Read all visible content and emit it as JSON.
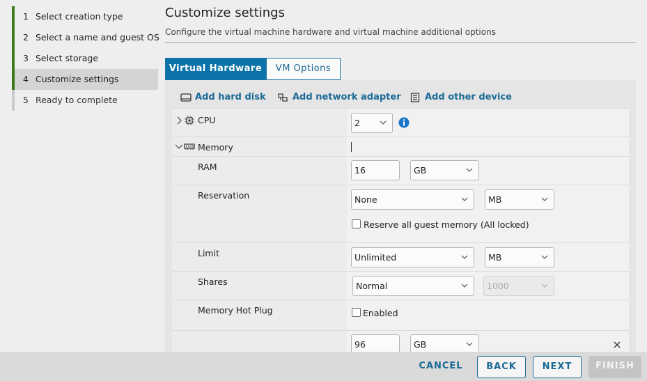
{
  "steps": [
    {
      "num": "1",
      "label": "Select creation type"
    },
    {
      "num": "2",
      "label": "Select a name and guest OS"
    },
    {
      "num": "3",
      "label": "Select storage"
    },
    {
      "num": "4",
      "label": "Customize settings"
    },
    {
      "num": "5",
      "label": "Ready to complete"
    }
  ],
  "page": {
    "title": "Customize settings",
    "subtitle": "Configure the virtual machine hardware and virtual machine additional options"
  },
  "tabs": {
    "virtual_hardware": "Virtual Hardware",
    "vm_options": "VM Options"
  },
  "actions": {
    "add_hard_disk": "Add hard disk",
    "add_network_adapter": "Add network adapter",
    "add_other_device": "Add other device"
  },
  "hardware": {
    "cpu": {
      "label": "CPU",
      "value": "2"
    },
    "memory": {
      "label": "Memory",
      "ram": {
        "label": "RAM",
        "value": "16",
        "unit": "GB"
      },
      "reservation": {
        "label": "Reservation",
        "value": "None",
        "unit": "MB",
        "checkbox_label": "Reserve all guest memory (All locked)",
        "checked": false
      },
      "limit": {
        "label": "Limit",
        "value": "Unlimited",
        "unit": "MB"
      },
      "shares": {
        "label": "Shares",
        "value": "Normal",
        "number": "1000"
      },
      "hot_plug": {
        "label": "Memory Hot Plug",
        "checkbox_label": "Enabled",
        "checked": false
      }
    },
    "hard_disk": {
      "value": "96",
      "unit": "GB"
    }
  },
  "footer": {
    "cancel": "CANCEL",
    "back": "BACK",
    "next": "NEXT",
    "finish": "FINISH"
  },
  "colors": {
    "accent": "#0b73a8",
    "link": "#1b6a96",
    "step_done": "#3d7a1e",
    "info": "#1b74c9"
  },
  "icons": [
    "cpu-icon",
    "memory-icon",
    "hard-disk-icon",
    "network-adapter-icon",
    "other-device-icon",
    "info-icon",
    "chevron-down-icon",
    "chevron-right-icon",
    "close-icon"
  ]
}
